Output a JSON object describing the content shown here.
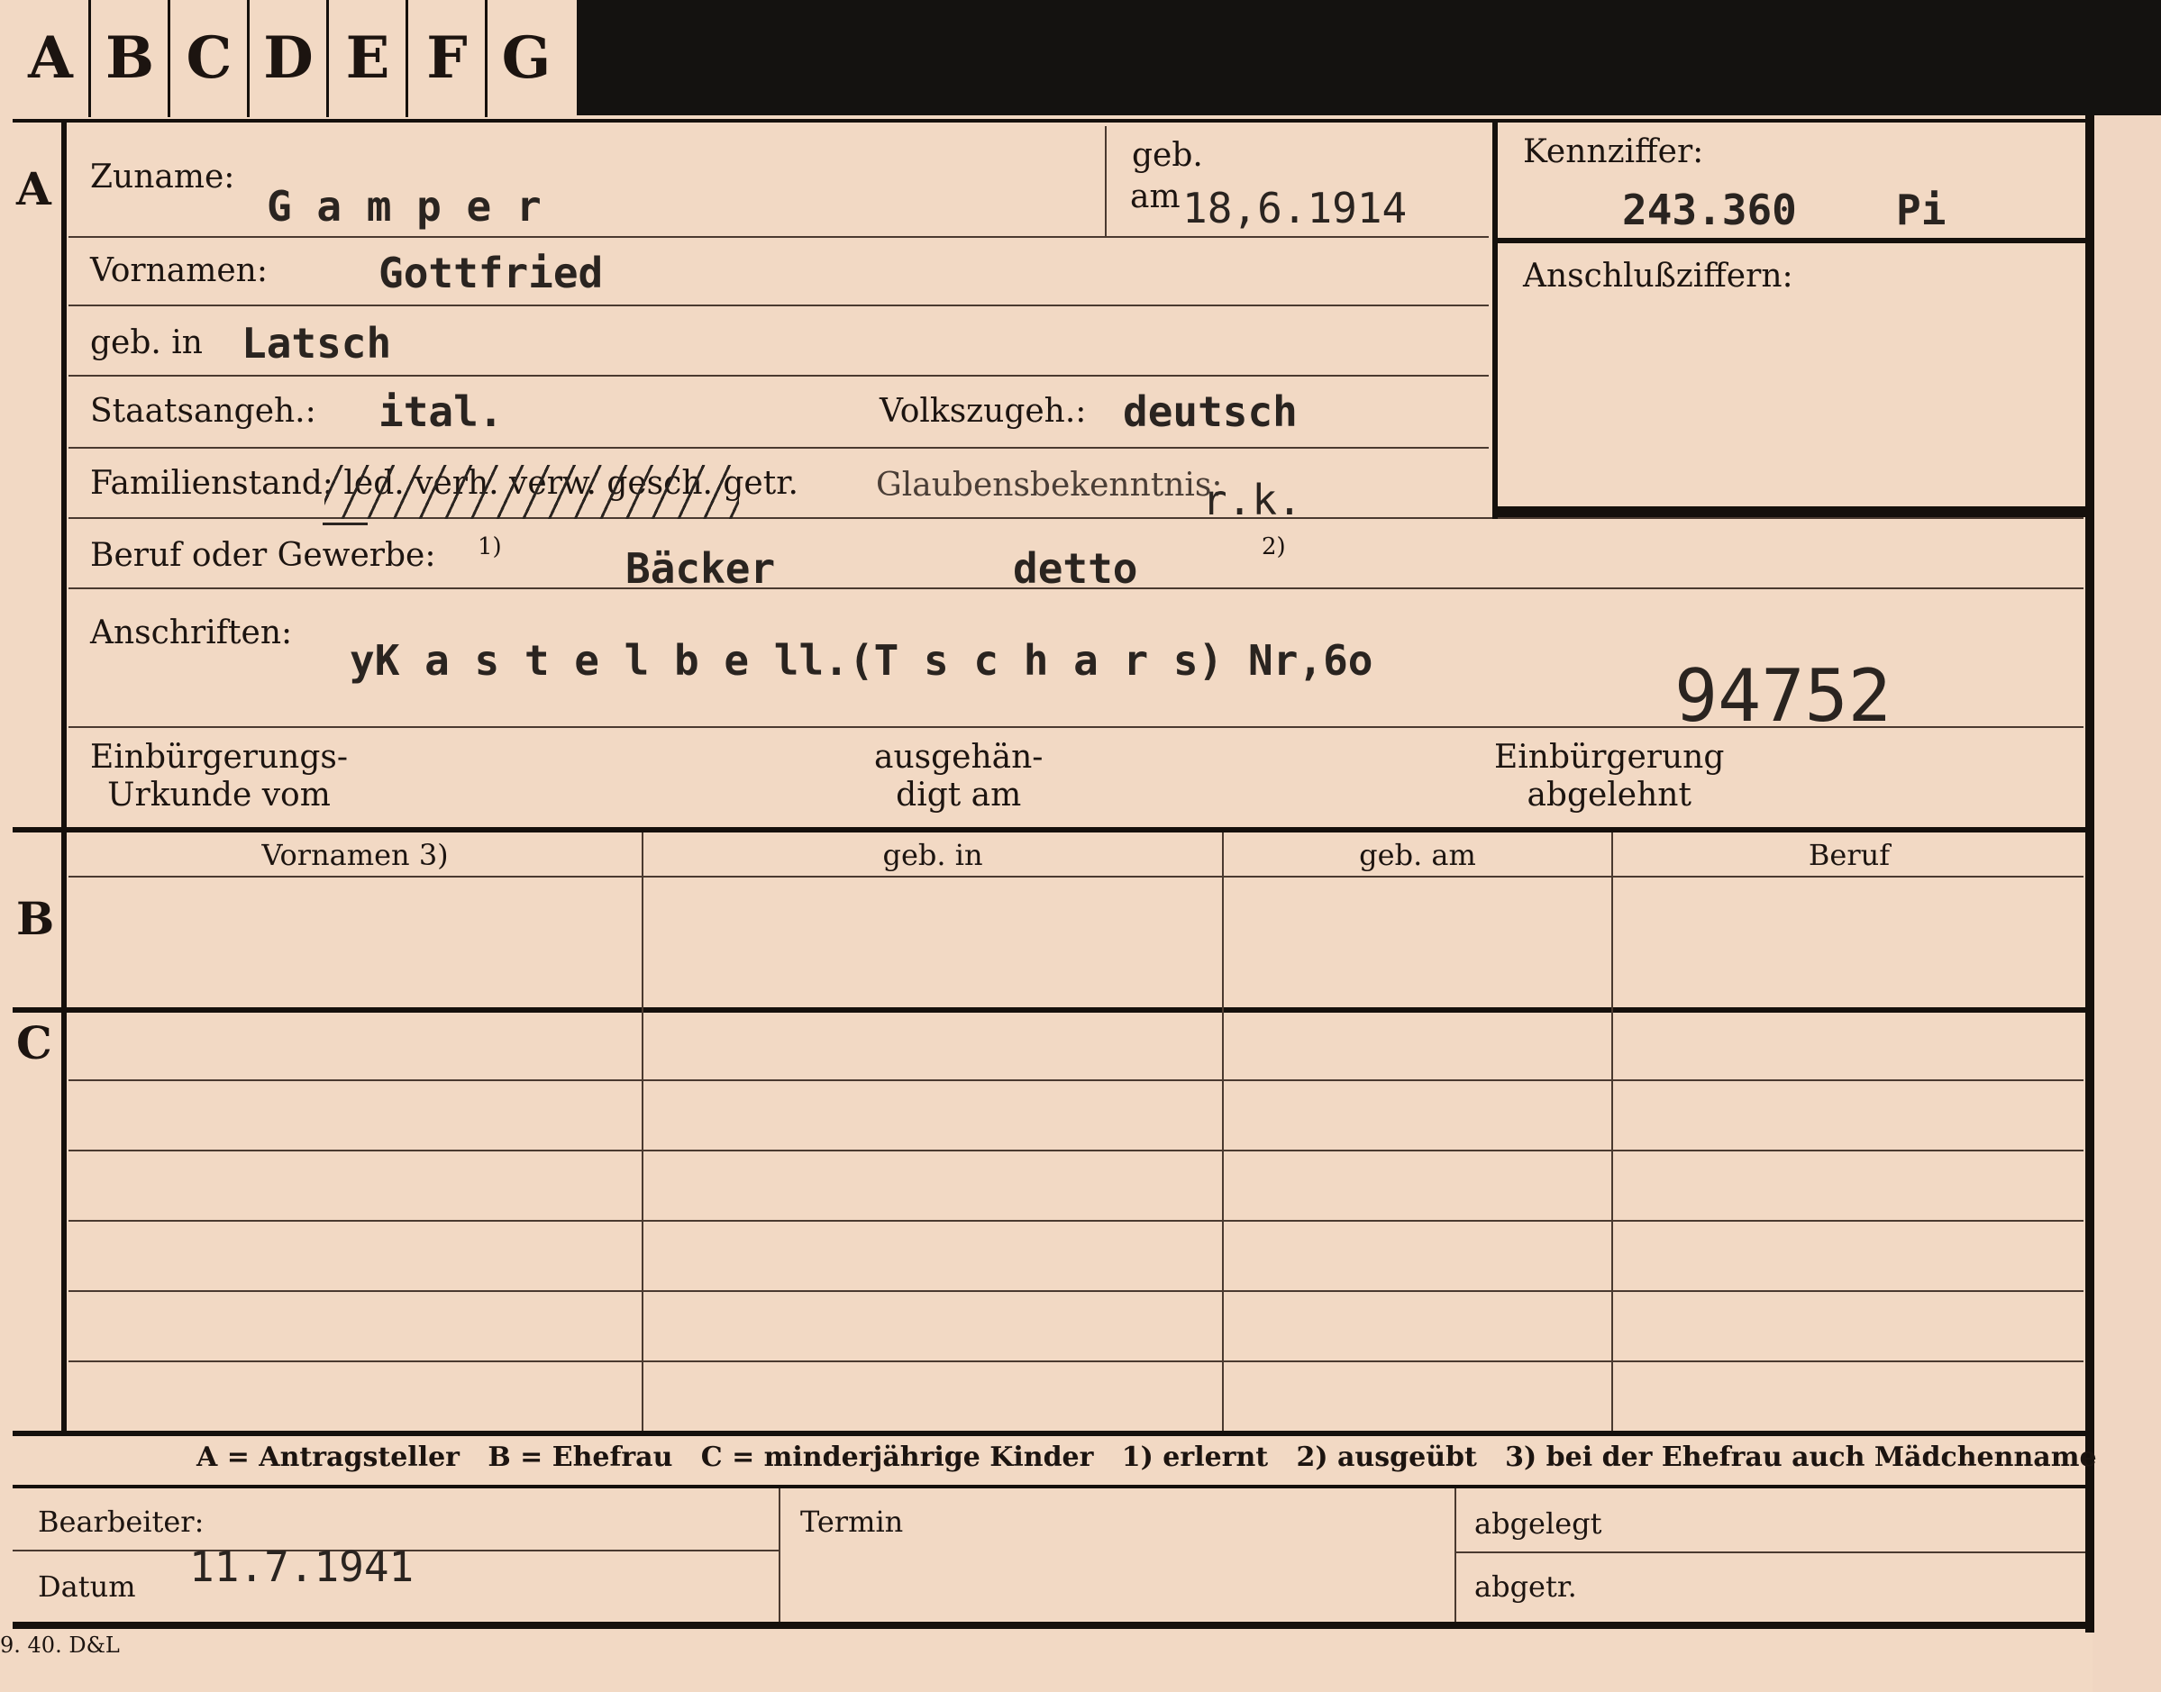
{
  "tabs": [
    "A",
    "B",
    "C",
    "D",
    "E",
    "F",
    "G"
  ],
  "section_labels": {
    "a": "A",
    "b": "B",
    "c": "C"
  },
  "fields": {
    "zuname_label": "Zuname:",
    "zuname_value": "G a m p e r",
    "geb_label": "geb.",
    "am_label": "am",
    "geb_am_value": "18,6.1914",
    "kennziffer_label": "Kennziffer:",
    "kennziffer_value": "243.360",
    "kennziffer_suffix": "Pi",
    "anschluss_label": "Anschlußziffern:",
    "vornamen_label": "Vornamen:",
    "vornamen_value": "Gottfried",
    "gebin_label": "geb. in",
    "gebin_value": "Latsch",
    "staat_label": "Staatsangeh.:",
    "staat_value": "ital.",
    "volks_label": "Volkszugeh.:",
    "volks_value": "deutsch",
    "familien_label": "Familienstand: led. verh. verw. gesch. getr.",
    "glauben_label": "Glaubensbekenntnis:",
    "glauben_value": "r.k.",
    "beruf_label": "Beruf oder Gewerbe:",
    "beruf_note1": "1)",
    "beruf_value": "Bäcker",
    "beruf_value2": "detto",
    "beruf_note2": "2)",
    "anschriften_label": "Anschriften:",
    "anschriften_value": "yK a s t e l b e ll.(T s c h a r s) Nr,6o",
    "stamp_number": "94752",
    "einb_urkunde_label": "Einbürgerungs-\nUrkunde vom",
    "ausgehaendigt_label": "ausgehän-\ndigt am",
    "einb_abgelehnt_label": "Einbürgerung\nabgelehnt"
  },
  "table_headers": [
    "Vornamen 3)",
    "geb. in",
    "geb. am",
    "Beruf"
  ],
  "legend": "A = Antragsteller   B = Ehefrau   C = minderjährige Kinder   1) erlernt   2) ausgeübt   3) bei der Ehefrau auch Mädchenname",
  "footer": {
    "bearbeiter_label": "Bearbeiter:",
    "datum_label": "Datum",
    "datum_value": "11.7.1941",
    "termin_label": "Termin",
    "abgelegt_label": "abgelegt",
    "abgetr_label": "abgetr."
  },
  "print_code": "9. 40. D&L"
}
